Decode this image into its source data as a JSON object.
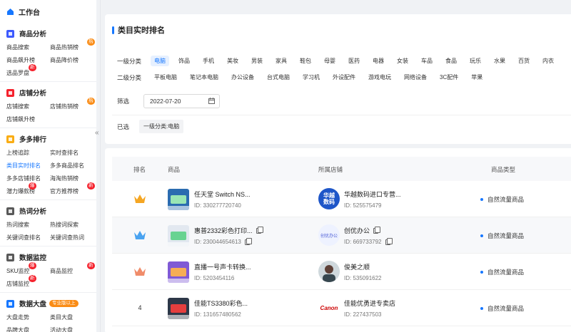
{
  "sidebar": {
    "top_label": "工作台",
    "collapse_glyph": "«",
    "groups": [
      {
        "title": "商品分析",
        "icon": "bag-icon",
        "color": "#3d5afe",
        "items": [
          {
            "label": "商品搜索"
          },
          {
            "label": "商品热销榜",
            "badge": "热"
          },
          {
            "label": "商品飙升榜"
          },
          {
            "label": "商品降价榜"
          },
          {
            "label": "选品罗盘",
            "badge": "新"
          }
        ]
      },
      {
        "title": "店铺分析",
        "icon": "store-icon",
        "color": "#f5222d",
        "items": [
          {
            "label": "店铺搜索"
          },
          {
            "label": "店铺热销榜",
            "badge": "热"
          },
          {
            "label": "店铺飙升榜"
          }
        ]
      },
      {
        "title": "多多排行",
        "icon": "trophy-icon",
        "color": "#faad14",
        "items": [
          {
            "label": "上榜追踪"
          },
          {
            "label": "实时查排名"
          },
          {
            "label": "类目实时排名",
            "active": true
          },
          {
            "label": "多多商品排名"
          },
          {
            "label": "多多店铺排名"
          },
          {
            "label": "海淘热销榜"
          },
          {
            "label": "潜力爆款榜",
            "badge": "爆"
          },
          {
            "label": "官方推荐榜",
            "badge": "新"
          }
        ]
      },
      {
        "title": "热词分析",
        "icon": "hot-word-icon",
        "color": "#595959",
        "items": [
          {
            "label": "热词搜索"
          },
          {
            "label": "热搜词探索"
          },
          {
            "label": "关键词查排名"
          },
          {
            "label": "关键词查热词"
          }
        ]
      },
      {
        "title": "数据监控",
        "icon": "monitor-icon",
        "color": "#595959",
        "items": [
          {
            "label": "SKU监控",
            "badge": "爆"
          },
          {
            "label": "商品监控",
            "badge": "新"
          },
          {
            "label": "店铺监控",
            "badge": "新"
          }
        ]
      },
      {
        "title": "数据大盘",
        "icon": "dashboard-icon",
        "color": "#1677ff",
        "pill": "专业版以上",
        "items": [
          {
            "label": "大盘走势"
          },
          {
            "label": "类目大盘"
          },
          {
            "label": "品牌大盘"
          },
          {
            "label": "活动大盘"
          }
        ]
      }
    ]
  },
  "filter": {
    "title": "类目实时排名",
    "level1_label": "一级分类",
    "level1": [
      "电脑",
      "饰品",
      "手机",
      "美妆",
      "男装",
      "家具",
      "鞋包",
      "母婴",
      "医药",
      "电器",
      "女装",
      "车品",
      "食品",
      "玩乐",
      "水果",
      "百货",
      "内衣"
    ],
    "level1_selected": 0,
    "level2_label": "二级分类",
    "level2": [
      "平板电脑",
      "笔记本电脑",
      "办公设备",
      "台式电脑",
      "学习机",
      "外设配件",
      "游戏电玩",
      "网络设备",
      "3C配件",
      "苹果"
    ],
    "screen_label": "筛选",
    "date": "2022-07-20",
    "selected_label": "已选",
    "selected_tag": "一级分类:电脑"
  },
  "table": {
    "headers": {
      "rank": "排名",
      "product": "商品",
      "shop": "所属店铺",
      "type": "商品类型"
    },
    "rows": [
      {
        "rank": "1",
        "crown": "#f5a623",
        "product": "任天堂 Switch NS...",
        "product_id": "ID: 330277720740",
        "shop": "华越数码进口专营...",
        "shop_id": "ID: 525575479",
        "shop_logo_text": "华越数码",
        "type": "自然流量商品"
      },
      {
        "rank": "2",
        "crown": "#4aa3f0",
        "product": "惠普2332彩色打印...",
        "product_id": "ID: 230044654613",
        "shop": "创优办公",
        "shop_id": "ID: 669733792",
        "shop_logo_text": "创优办公",
        "type": "自然流量商品"
      },
      {
        "rank": "3",
        "crown": "#f08c6a",
        "product": "直播一号声卡转换...",
        "product_id": "ID: 5203454116",
        "shop": "俊美之顺",
        "shop_id": "ID: 535091622",
        "shop_logo_text": "",
        "type": "自然流量商品"
      },
      {
        "rank": "4",
        "crown": "",
        "product": "佳能TS3380彩色...",
        "product_id": "ID: 131657480562",
        "shop": "佳能优勇进专卖店",
        "shop_id": "ID: 227437503",
        "shop_logo_text": "Canon",
        "type": "自然流量商品"
      }
    ]
  }
}
